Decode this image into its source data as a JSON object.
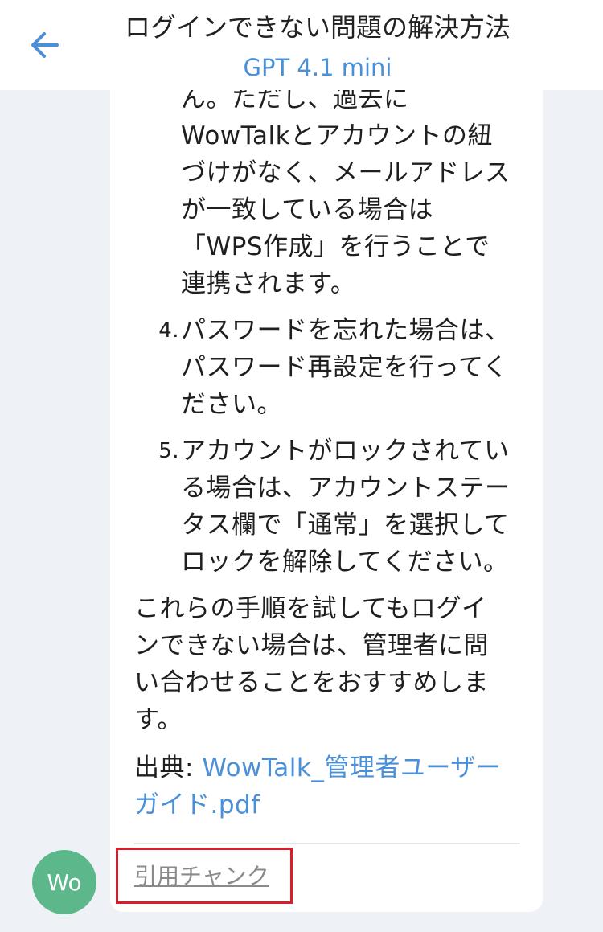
{
  "header": {
    "title": "ログインできない問題の解決方法",
    "model": "GPT 4.1 mini",
    "back_icon": "arrow-left-icon",
    "accent_color": "#4a90d9"
  },
  "message": {
    "item3_text": "ん。ただし、過去に\nWowTalkとアカウントの紐\nづけがなく、メールアドレス\nが一致している場合は\n「WPS作成」を行うことで\n連携されます。",
    "items": [
      {
        "number": "4.",
        "text": "パスワードを忘れた場合は、\nパスワード再設定を行ってく\nださい。"
      },
      {
        "number": "5.",
        "text": "アカウントがロックされてい\nる場合は、アカウントステー\nタス欄で「通常」を選択して\nロックを解除してください。"
      }
    ],
    "closing": "これらの手順を試してもログイ\nンできない場合は、管理者に問\nい合わせることをおすすめしま\nす。",
    "source_label": "出典: ",
    "source_file": "WowTalk_管理者ユーザー\nガイド.pdf",
    "chunk_link": "引用チャンク"
  },
  "avatar": {
    "initials": "Wo",
    "color": "#5cb88a"
  },
  "highlight_color": "#d81e2b"
}
